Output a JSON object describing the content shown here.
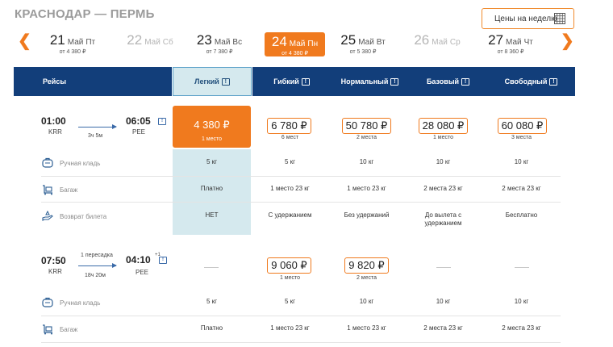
{
  "route_title": "КРАСНОДАР — ПЕРМЬ",
  "week_button_label": "Цены на неделю",
  "date_strip": [
    {
      "day": "21",
      "month": "Май",
      "weekday": "Пт",
      "price": "от 4 380 ₽"
    },
    {
      "day": "22",
      "month": "Май",
      "weekday": "Сб",
      "price": ""
    },
    {
      "day": "23",
      "month": "Май",
      "weekday": "Вс",
      "price": "от 7 380 ₽"
    },
    {
      "day": "24",
      "month": "Май",
      "weekday": "Пн",
      "price": "от 4 380 ₽"
    },
    {
      "day": "25",
      "month": "Май",
      "weekday": "Вт",
      "price": "от 5 380 ₽"
    },
    {
      "day": "26",
      "month": "Май",
      "weekday": "Ср",
      "price": ""
    },
    {
      "day": "27",
      "month": "Май",
      "weekday": "Чт",
      "price": "от 8 360 ₽"
    }
  ],
  "header": {
    "flights": "Рейсы",
    "tariffs": [
      "Легкий",
      "Гибкий",
      "Нормальный",
      "Базовый",
      "Свободный"
    ]
  },
  "info_glyph": "!",
  "row_labels": {
    "hand_luggage": "Ручная кладь",
    "baggage": "Багаж",
    "refund": "Возврат билета"
  },
  "flight1": {
    "depart_time": "01:00",
    "depart_code": "KRR",
    "arrive_time": "06:05",
    "arrive_code": "PEE",
    "duration": "3ч 5м",
    "best_price": "4 380 ₽",
    "best_seats": "1 место",
    "prices": [
      {
        "amount": "6 780 ₽",
        "seats": "6 мест"
      },
      {
        "amount": "50 780 ₽",
        "seats": "2 места"
      },
      {
        "amount": "28 080 ₽",
        "seats": "1 место"
      },
      {
        "amount": "60 080 ₽",
        "seats": "3 места"
      }
    ],
    "hand_luggage": [
      "5 кг",
      "5 кг",
      "10 кг",
      "10 кг",
      "10 кг"
    ],
    "baggage": [
      "Платно",
      "1 место 23 кг",
      "1 место 23 кг",
      "2 места 23 кг",
      "2 места 23 кг"
    ],
    "refund": [
      "НЕТ",
      "С удержанием",
      "Без удержаний",
      "До вылета с удержанием",
      "Бесплатно"
    ]
  },
  "flight2": {
    "depart_time": "07:50",
    "depart_code": "KRR",
    "arrive_time": "04:10",
    "arrive_sup": "+1",
    "arrive_code": "PEE",
    "stops": "1 пересадка",
    "duration": "18ч 20м",
    "prices": [
      {
        "amount": "9 060 ₽",
        "seats": "1 место"
      },
      {
        "amount": "9 820 ₽",
        "seats": "2 места"
      }
    ],
    "hand_luggage": [
      "5 кг",
      "5 кг",
      "10 кг",
      "10 кг",
      "10 кг"
    ],
    "baggage": [
      "Платно",
      "1 место 23 кг",
      "1 место 23 кг",
      "2 места 23 кг",
      "2 места 23 кг"
    ]
  },
  "colors": {
    "accent": "#f07a1e",
    "navy": "#123e7a",
    "highlight": "#d5e9ee"
  }
}
